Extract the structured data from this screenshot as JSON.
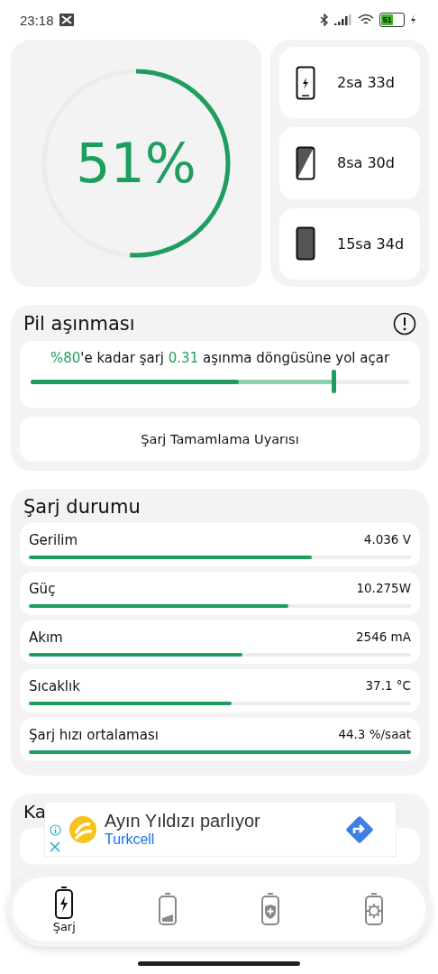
{
  "status_bar": {
    "time": "23:18",
    "battery": "51"
  },
  "charge_ring": {
    "level": 0.51,
    "percent": "51%"
  },
  "estimates": [
    {
      "kind": "charging",
      "time": "2sa 33d"
    },
    {
      "kind": "half",
      "time": "8sa 30d"
    },
    {
      "kind": "full",
      "time": "15sa 34d"
    }
  ],
  "wear": {
    "title": "Pil aşınması",
    "sentence": [
      {
        "text": "%80",
        "highlight": true
      },
      {
        "text": "'e kadar şarj ",
        "highlight": false
      },
      {
        "text": "0.31",
        "highlight": true
      },
      {
        "text": " aşınma döngüsüne yol açar",
        "highlight": false
      }
    ],
    "slider": {
      "level": 0.8
    },
    "current": {
      "level": 0.55
    },
    "button": "Şarj Tamamlama Uyarısı"
  },
  "charge_status": {
    "title": "Şarj durumu",
    "rows": [
      {
        "label": "Gerilim",
        "value": "4.036 V",
        "level": 0.74
      },
      {
        "label": "Güç",
        "value": "10.275W",
        "level": 0.68
      },
      {
        "label": "Akım",
        "value": "2546 mA",
        "level": 0.56
      },
      {
        "label": "Sıcaklık",
        "value": "37.1 °C",
        "level": 0.53
      },
      {
        "label": "Şarj hızı ortalaması",
        "value": "44.3 %/saat",
        "level": 1.0
      }
    ]
  },
  "partial_card": {
    "title": "Ka"
  },
  "ad": {
    "headline": "Ayın Yıldızı parlıyor",
    "advertiser": "Turkcell"
  },
  "bottom_nav": [
    {
      "kind": "charging",
      "label": "Şarj",
      "selected": true
    },
    {
      "kind": "battery",
      "selected": false
    },
    {
      "kind": "shield",
      "selected": false
    },
    {
      "kind": "gear",
      "selected": false
    }
  ]
}
